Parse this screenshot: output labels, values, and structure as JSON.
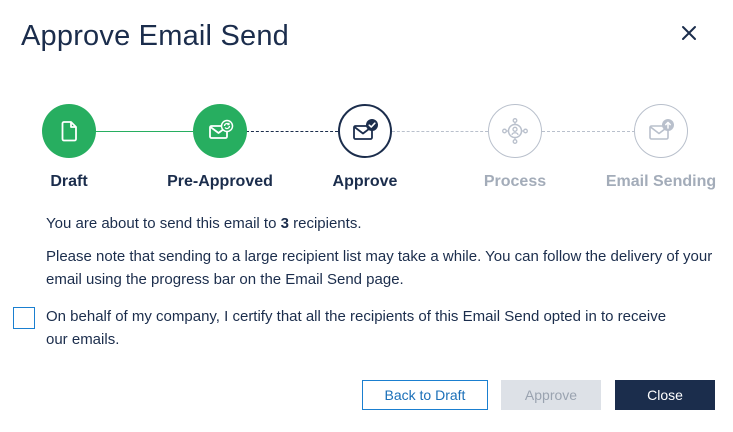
{
  "dialog": {
    "title": "Approve Email Send"
  },
  "stepper": {
    "steps": [
      {
        "label": "Draft",
        "state": "done",
        "icon": "document-icon"
      },
      {
        "label": "Pre-Approved",
        "state": "done",
        "icon": "email-refresh-icon"
      },
      {
        "label": "Approve",
        "state": "current",
        "icon": "email-check-icon"
      },
      {
        "label": "Process",
        "state": "future",
        "icon": "user-network-icon"
      },
      {
        "label": "Email Sending",
        "state": "future",
        "icon": "email-upload-icon"
      }
    ],
    "colors": {
      "done": "#27ae60",
      "current": "#1b2d4c",
      "future": "#b9c0cc"
    }
  },
  "message": {
    "line1_prefix": "You are about to send this email to ",
    "recipient_count": "3",
    "line1_suffix": " recipients.",
    "line2": "Please note that sending to a large recipient list may take a while. You can follow the delivery of your email using the progress bar on the Email Send page."
  },
  "certify": {
    "checked": false,
    "text": "On behalf of my company, I certify that all the recipients of this Email Send opted in to receive our emails."
  },
  "buttons": {
    "back_label": "Back to Draft",
    "approve_label": "Approve",
    "close_label": "Close"
  }
}
